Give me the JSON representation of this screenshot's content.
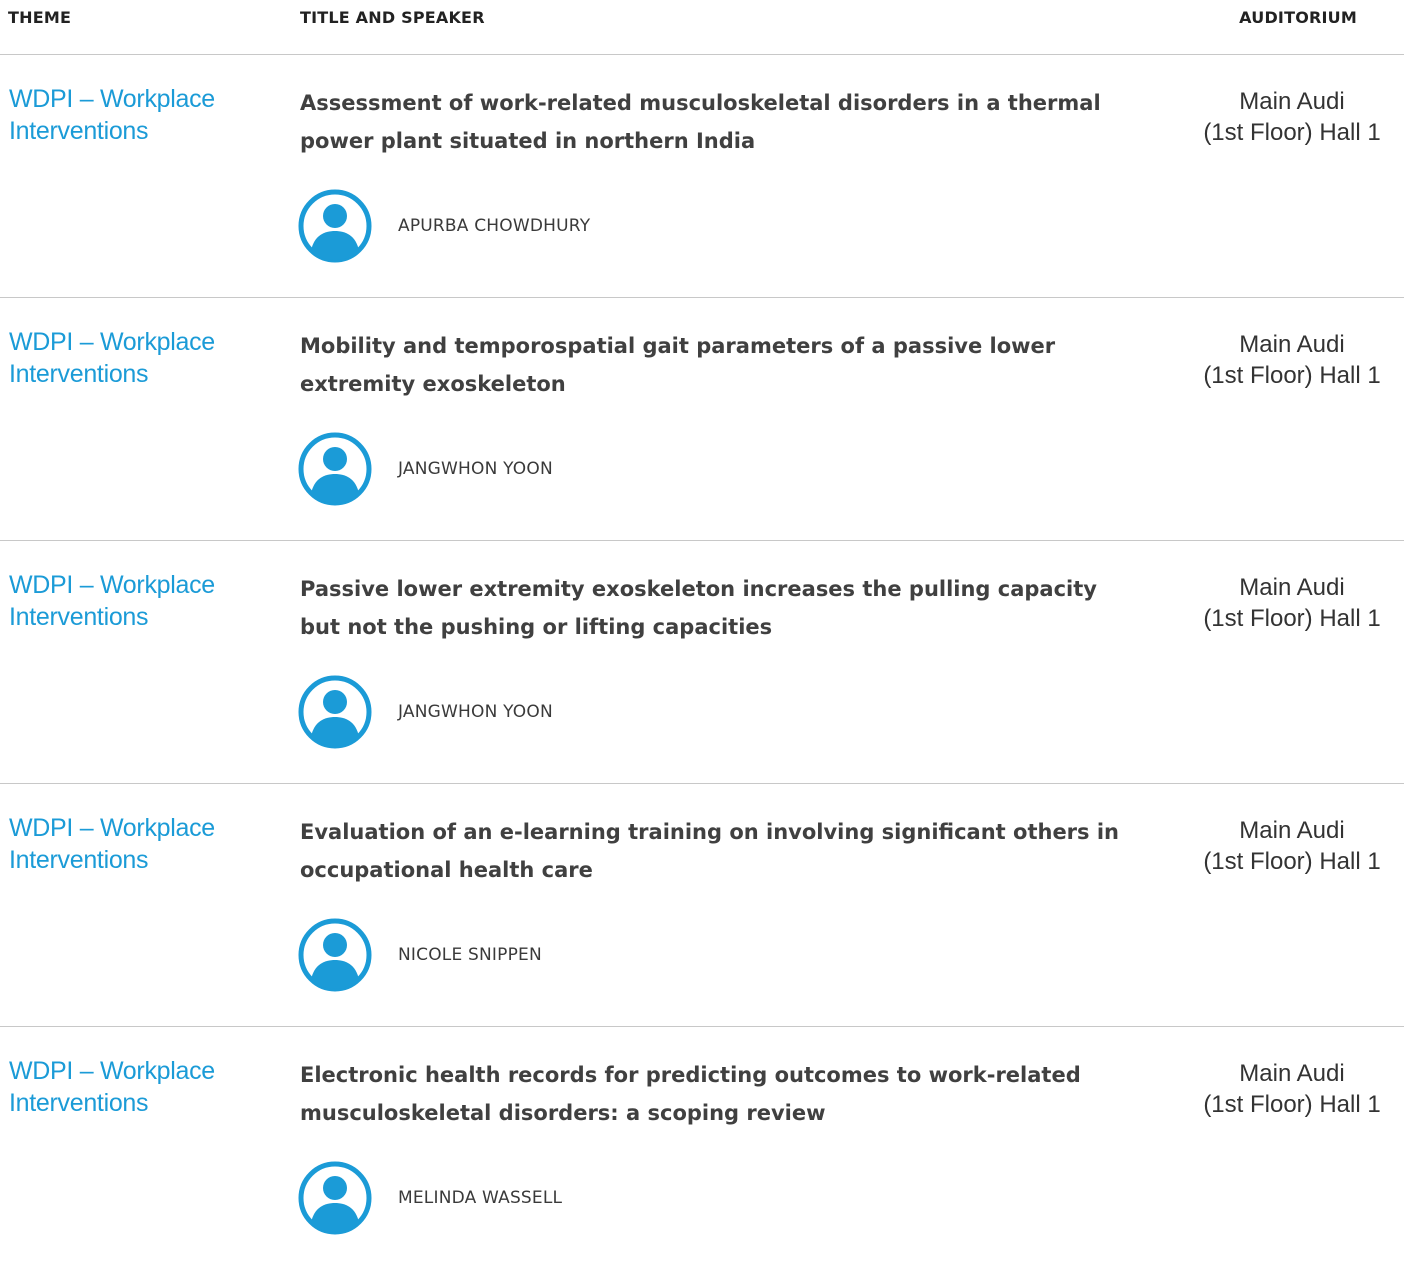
{
  "header": {
    "theme": "THEME",
    "title_speaker": "TITLE AND SPEAKER",
    "auditorium": "AUDITORIUM"
  },
  "accent_color": "#1b9bd7",
  "avatar_icon": "user-avatar-icon",
  "sessions": [
    {
      "theme": "WDPI – Workplace Interventions",
      "title": "Assessment of work-related musculoskeletal disorders in a thermal power plant situated in northern India",
      "speaker": "APURBA CHOWDHURY",
      "auditorium_line1": "Main Audi",
      "auditorium_line2": "(1st Floor) Hall 1"
    },
    {
      "theme": "WDPI – Workplace Interventions",
      "title": "Mobility and temporospatial gait parameters of a passive lower extremity exoskeleton",
      "speaker": "JANGWHON YOON",
      "auditorium_line1": "Main Audi",
      "auditorium_line2": "(1st Floor) Hall 1"
    },
    {
      "theme": "WDPI – Workplace Interventions",
      "title": "Passive lower extremity exoskeleton increases the pulling capacity but not the pushing or lifting capacities",
      "speaker": "JANGWHON YOON",
      "auditorium_line1": "Main Audi",
      "auditorium_line2": "(1st Floor) Hall 1"
    },
    {
      "theme": "WDPI – Workplace Interventions",
      "title": "Evaluation of an e-learning training on involving significant others in occupational health care",
      "speaker": "NICOLE SNIPPEN",
      "auditorium_line1": "Main Audi",
      "auditorium_line2": "(1st Floor) Hall 1"
    },
    {
      "theme": "WDPI – Workplace Interventions",
      "title": "Electronic health records for predicting outcomes to work-related musculoskeletal disorders: a scoping review",
      "speaker": "MELINDA WASSELL",
      "auditorium_line1": "Main Audi",
      "auditorium_line2": "(1st Floor) Hall 1"
    }
  ]
}
